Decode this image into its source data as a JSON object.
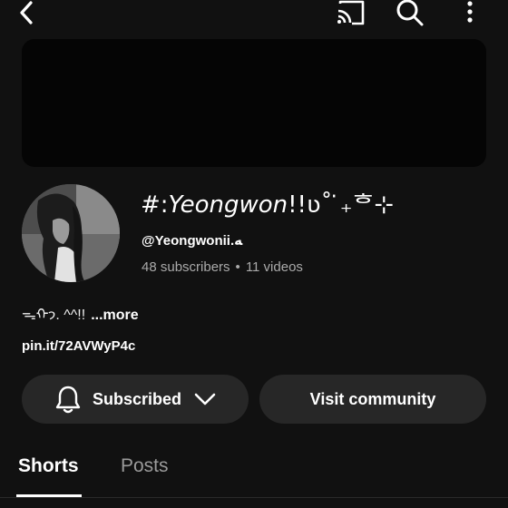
{
  "topbar": {
    "icons": [
      "back-arrow-icon",
      "cast-icon",
      "search-icon",
      "more-vertical-icon"
    ]
  },
  "channel": {
    "name_prefix": "#:",
    "name_main": "Yeongwon",
    "name_suffix": "!!ʋ˚ ̇₊ᄒ⊹",
    "handle": "@Yeongwonii.ﻪ",
    "subscribers": "48 subscribers",
    "separator": "•",
    "videos": "11 videos",
    "description": "ᯓᡣ𐭩. ^^!!",
    "more_label": "...more",
    "link": "pin.it/72AVWyP4c"
  },
  "actions": {
    "subscribe_label": "Subscribed",
    "community_label": "Visit community"
  },
  "tabs": {
    "shorts": "Shorts",
    "posts": "Posts",
    "active": "Shorts"
  },
  "colors": {
    "background": "#111111",
    "pill": "#272727",
    "secondary_text": "#aaaaaa"
  }
}
